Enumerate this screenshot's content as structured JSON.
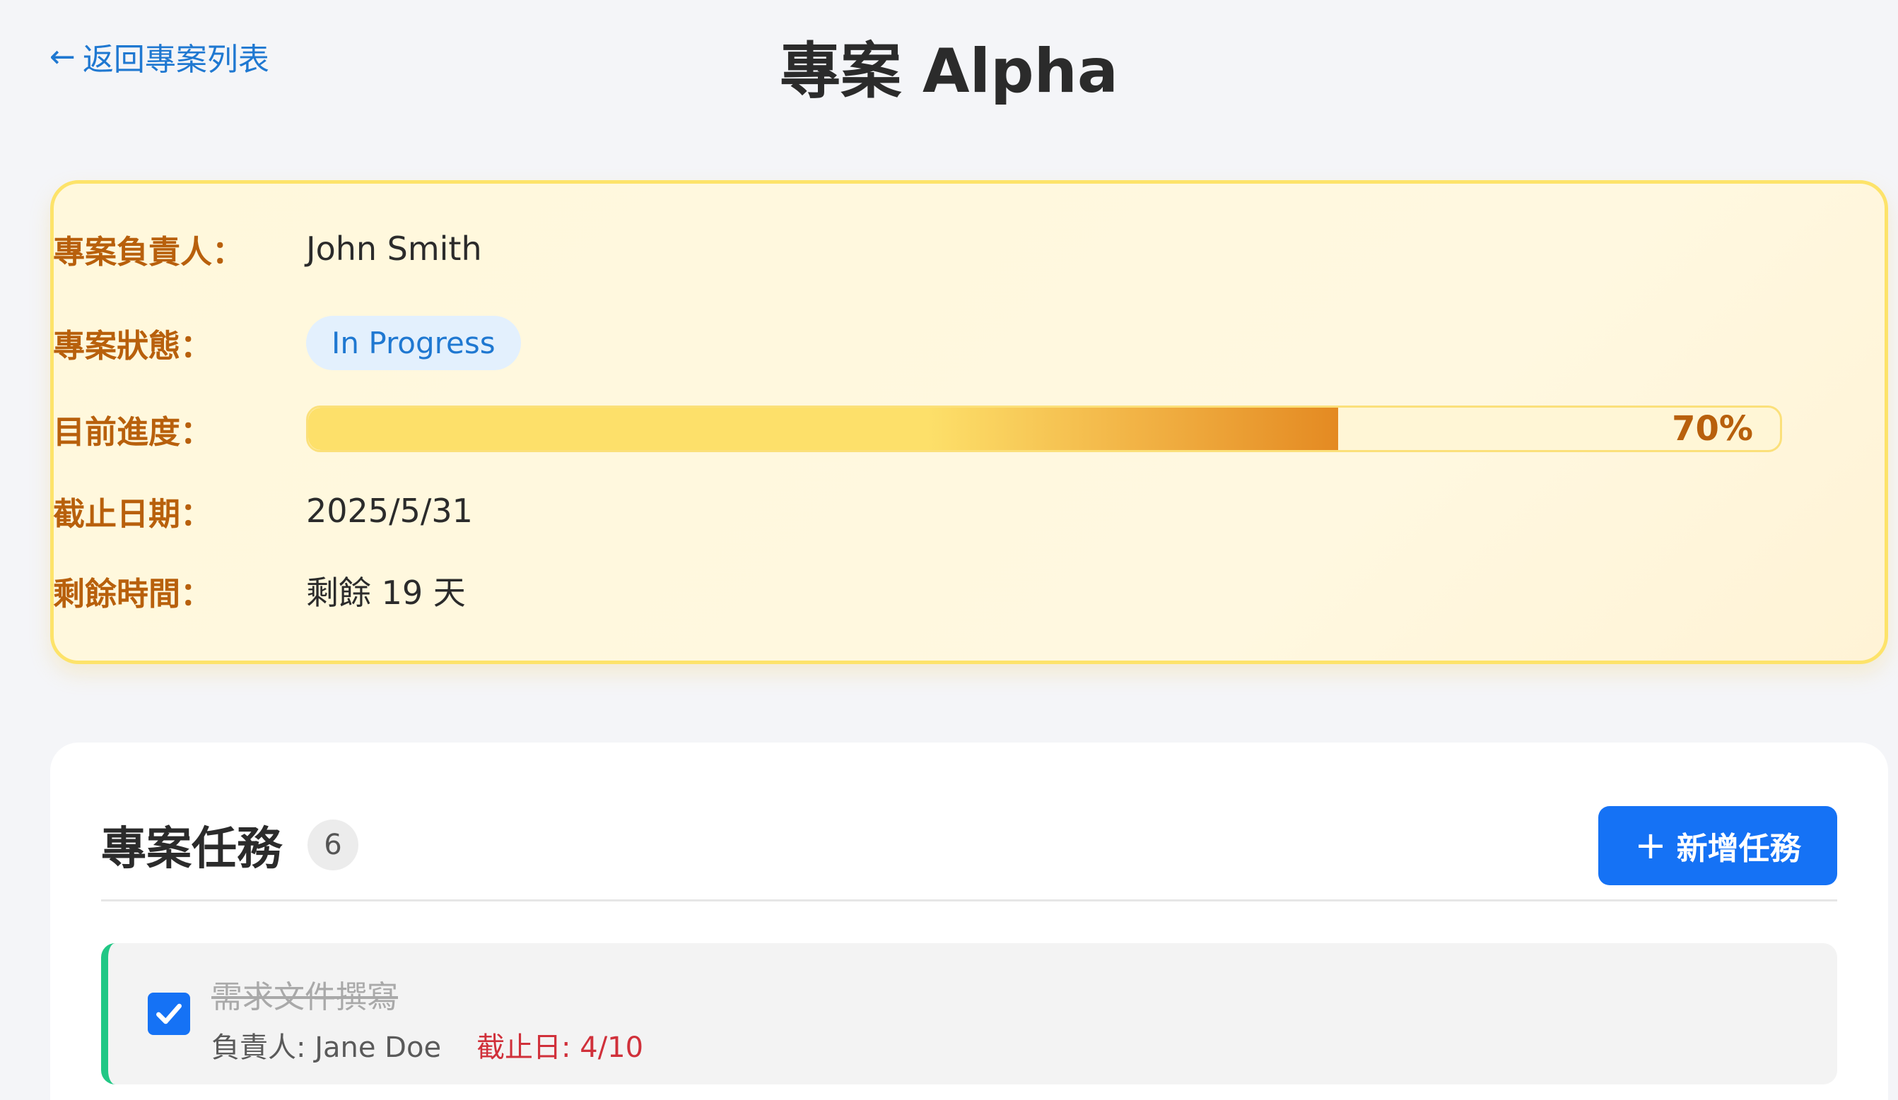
{
  "header": {
    "back_arrow": "←",
    "back_label": "返回專案列表",
    "title": "專案 Alpha"
  },
  "info": {
    "owner_label": "專案負責人：",
    "owner_value": "John Smith",
    "status_label": "專案狀態：",
    "status_value": "In Progress",
    "progress_label": "目前進度：",
    "progress_value": 0.7,
    "progress_text": "70%",
    "deadline_label": "截止日期：",
    "deadline_value": "2025/5/31",
    "remaining_label": "剩餘時間：",
    "remaining_value": "剩餘 19 天"
  },
  "tasks": {
    "title": "專案任務",
    "count": "6",
    "add_icon": "+",
    "add_label": "新增任務",
    "items": [
      {
        "name": "需求文件撰寫",
        "completed": true,
        "assignee": "負責人: Jane Doe",
        "due": "截止日: 4/10"
      }
    ]
  },
  "colors": {
    "accent": "#1572f5",
    "link": "#1f78d1",
    "label": "#b8600c",
    "complete_border": "#22c785",
    "due": "#d0303a"
  },
  "icons": {
    "back": "arrow-left-icon",
    "add": "plus-icon",
    "check": "check-icon"
  }
}
